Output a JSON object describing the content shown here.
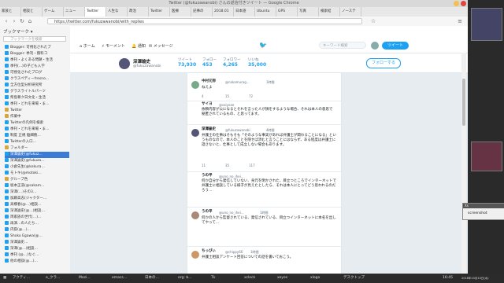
{
  "window": {
    "title": "Twitter (@fukuzawanobi) さんの返信付きツイート — Google Chrome"
  },
  "tabs": [
    "家族と",
    "相談と",
    "ゲーム",
    "ニュー",
    "Twitter",
    "人生な",
    "政治",
    "Twitter",
    "医療",
    "記事の",
    "2018.01",
    "日本語",
    "Ubuntu",
    "GPS",
    "写真",
    "検索結",
    "ノーステ"
  ],
  "url": "https://twitter.com/fukuzawanobi/with_replies",
  "sidebar": {
    "title": "ブックマーク ▾",
    "search_placeholder": "ブックマークを検索",
    "items": [
      "Blogger: 可視化されたブ",
      "Blogger: 季刊・無料コ",
      "季刊・よくある問題・生活",
      "季刊(...)の子ども入学",
      "可視化されたブログ",
      "クラスペディーfresno...",
      "全方位型分析研究所",
      "グラスライトルパーツ",
      "柴島尊ク日文化・生活",
      "季刊・どれを来場・ま…",
      "Twitter",
      "作業中",
      "Twitterの凡例を検索",
      "季刊・どれを来場・ま…",
      "制度 正規 脳細胞…",
      "Twitterの入口…",
      "フォルダー",
      "深澤論史(@fukuz…",
      "深澤論史(@fukuza…",
      "小倉先生(@kokura…",
      "モトキ(@motoki…",
      "グループ色",
      "坂本正浩(@sakam…",
      "深澤(…)その3…",
      "加藤高志(ジャクター…",
      "高橋春(@…)相談…",
      "深澤論史(@…)相談…",
      "両家族の世代(…)…",
      "再演…の人たち…",
      "内容(@…)…",
      "Shoko Egawa(@…",
      "深澤論史…",
      "深澤(@…)相談…",
      "季刊 (@…)なぐ…",
      "他の相談(@…)…"
    ],
    "selected_index": 17
  },
  "twitter_nav": {
    "home": "ホーム",
    "moments": "モーメント",
    "notifications": "通知",
    "messages": "メッセージ",
    "search_placeholder": "キーワード検索",
    "tweet_button": "ツイート"
  },
  "profile": {
    "name": "深澤諭史",
    "handle": "@fukuzawanobi",
    "stats": [
      {
        "label": "ツイート",
        "value": "73,930"
      },
      {
        "label": "フォロー",
        "value": "453"
      },
      {
        "label": "フォロワー",
        "value": "4,265"
      },
      {
        "label": "いいね",
        "value": "35,000"
      }
    ],
    "follow_label": "フォローする"
  },
  "tweets": [
    {
      "name": "中村元弥",
      "handle": "@nakamurag…",
      "time": "1時間",
      "text": "ねえよ",
      "counts": [
        "4",
        "15",
        "72"
      ]
    },
    {
      "name": "サイヨ",
      "handle": "@saiyoae",
      "time": "",
      "text": "依頼内容が公になるとそれを言った人が損をするような場合、それは本人の意思で秘匿されているもの、と思ってます。",
      "counts": [
        "3",
        "24",
        "35"
      ]
    },
    {
      "name": "深澤諭史",
      "handle": "@fukuzawanobi",
      "time": "4時間",
      "text": "弁護士の仕事はそもそも「そのような事実があれば弁護士が関わることになる」というものなので、本人のことを隠せば済むと言うことにはならず、ある程度は弁護士に話さないと、仕事として成立しない場合もあります。",
      "counts": [
        "11",
        "35",
        "117"
      ]
    },
    {
      "name": "うの平",
      "handle": "@uno_no_ihei…",
      "time": "",
      "text": "何か自分から発信していない、身元を明かされた、目立つところでインターネットで弁護士に相談している様子が見えたとしたら、それは本人にとってどう思われるのだろう…",
      "counts": [
        "1",
        "2",
        "14"
      ]
    },
    {
      "name": "うの平",
      "handle": "@uno_no_ihei…",
      "time": "1時間",
      "text": "何かの人から監督されている、発信されている、目立つインターネットに本名を出してやって…",
      "counts": [
        "",
        "",
        ""
      ]
    },
    {
      "name": "ちっぴぃ",
      "handle": "@chippy66",
      "time": "1時間",
      "text": "弁護士相談アンケート回答についての話を書いておこう。",
      "counts": [
        "",
        "",
        ""
      ]
    }
  ],
  "taskbar": {
    "items": [
      "アクティ…",
      "e_クラ…",
      "Mozi…",
      "emacs…",
      "日本の…",
      "org: b…",
      "Tk",
      "xclock",
      "xeyes",
      "xlogo",
      "デスクトップ"
    ],
    "clock": "16:45",
    "date": "2018年10月10日(水)"
  },
  "popup": {
    "title": "Xs",
    "label": "screenshot"
  },
  "colors": {
    "twitter_blue": "#1da1f2",
    "selected": "#3a7bd5"
  }
}
